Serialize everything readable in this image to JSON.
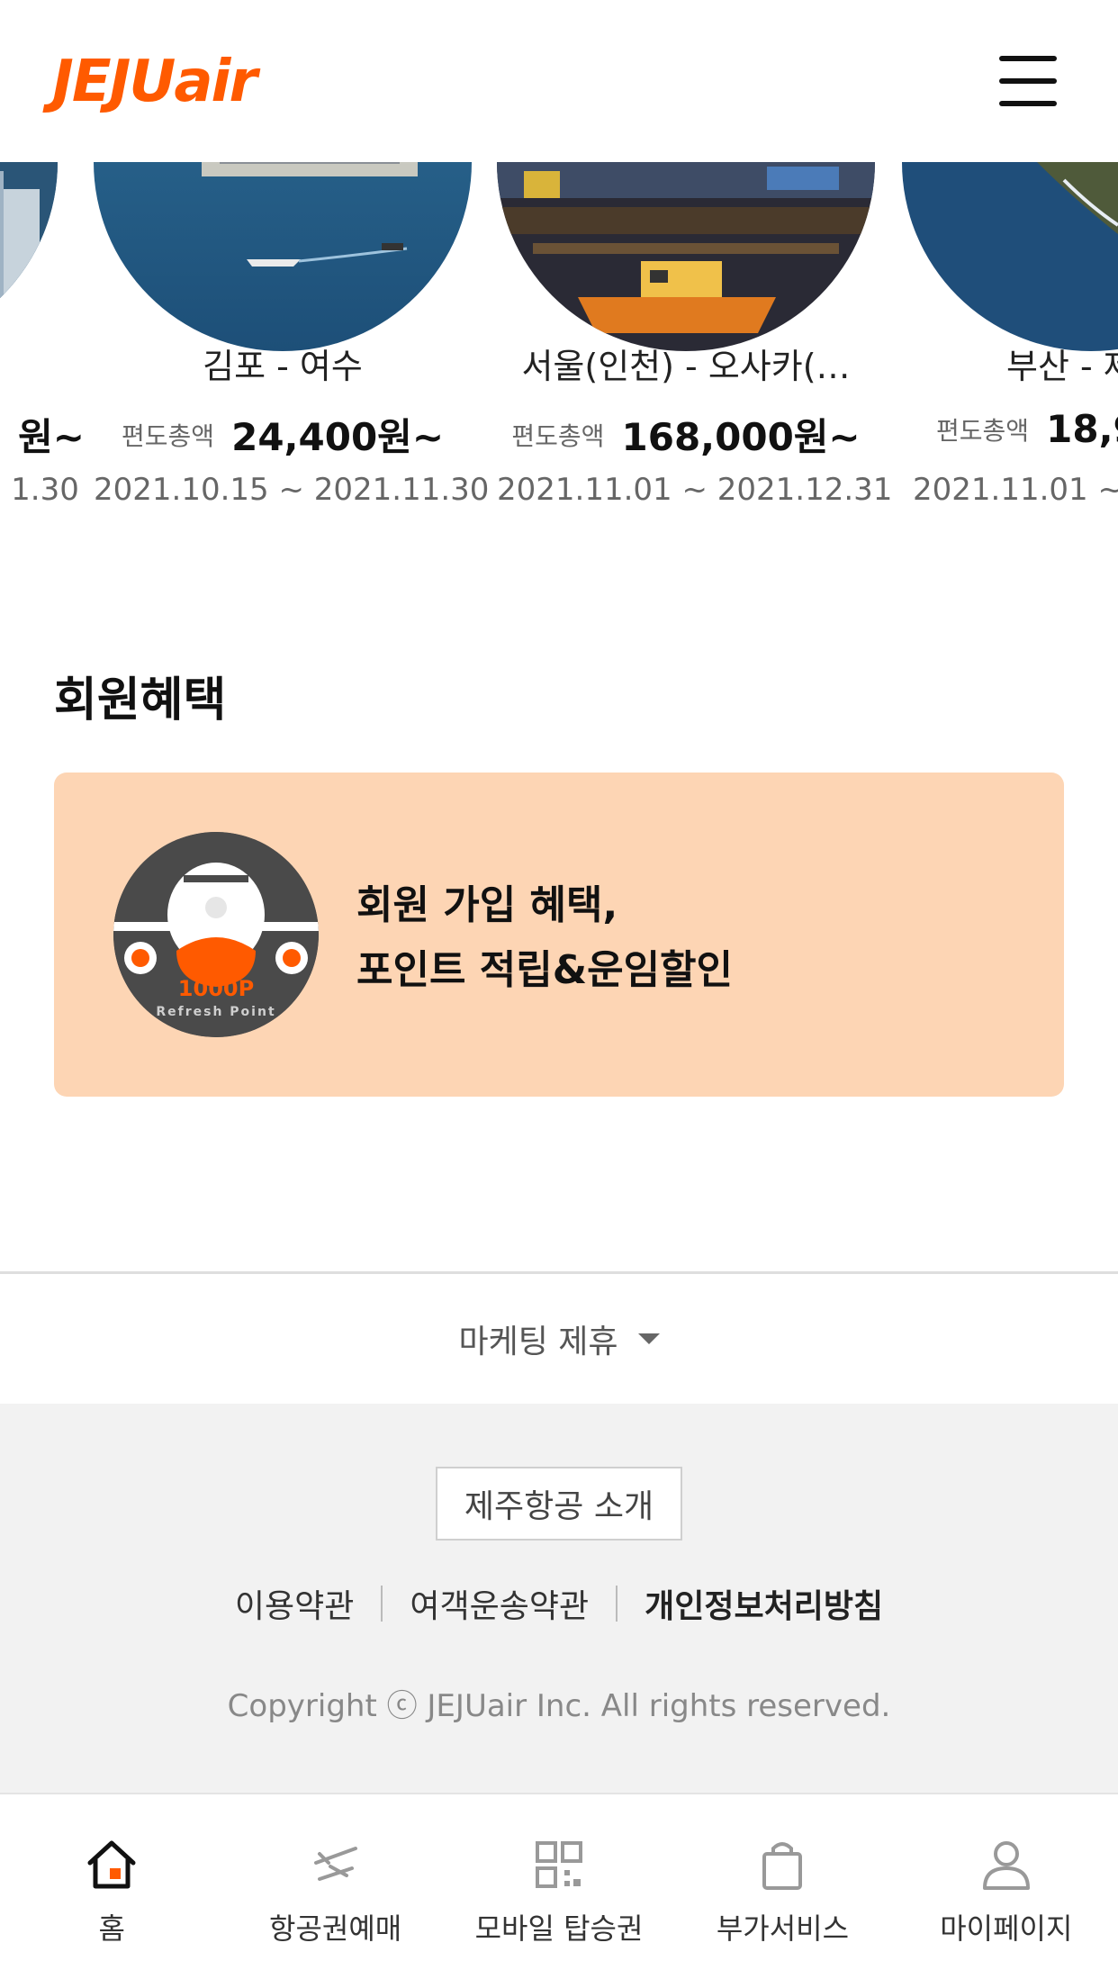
{
  "header": {
    "logo_text": "JEJUair",
    "logo_color": "#ff5a00"
  },
  "deals": [
    {
      "route": "",
      "price_label": "",
      "price": "원~",
      "dates": "1.30"
    },
    {
      "route": "김포 - 여수",
      "price_label": "편도총액",
      "price": "24,400원~",
      "dates": "2021.10.15 ~ 2021.11.30"
    },
    {
      "route": "서울(인천) - 오사카(…",
      "price_label": "편도총액",
      "price": "168,000원~",
      "dates": "2021.11.01 ~ 2021.12.31"
    },
    {
      "route": "부산 - 제",
      "price_label": "편도총액",
      "price": "18,9",
      "dates": "2021.11.01 ~ 2"
    }
  ],
  "benefits": {
    "title": "회원혜택",
    "card_line1": "회원 가입 혜택,",
    "card_line2": "포인트 적립&운임할인",
    "badge_points": "1000P",
    "badge_caption": "Refresh Point",
    "card_color": "#fdd5b4"
  },
  "footer": {
    "marketing_label": "마케팅 제휴",
    "intro_button": "제주항공 소개",
    "links": [
      "이용약관",
      "여객운송약관",
      "개인정보처리방침"
    ],
    "copyright": "Copyright ⓒ JEJUair Inc. All rights reserved."
  },
  "bottom_nav": [
    {
      "label": "홈",
      "icon": "home-icon"
    },
    {
      "label": "항공권예매",
      "icon": "airplane-ticket-icon"
    },
    {
      "label": "모바일 탑승권",
      "icon": "qr-code-icon"
    },
    {
      "label": "부가서비스",
      "icon": "shopping-bag-icon"
    },
    {
      "label": "마이페이지",
      "icon": "user-icon"
    }
  ]
}
